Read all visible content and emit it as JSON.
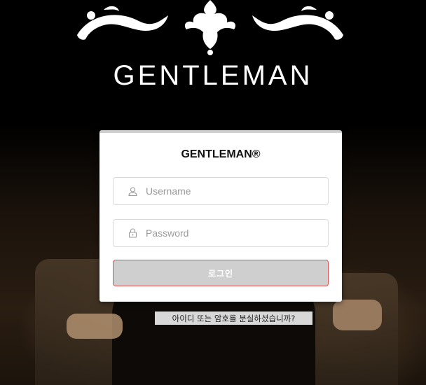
{
  "brand": {
    "name": "GENTLEMAN"
  },
  "login": {
    "title": "GENTLEMAN®",
    "username_placeholder": "Username",
    "password_placeholder": "Password",
    "submit_label": "로그인"
  },
  "forgot": {
    "label": "아이디 또는 암호를 분실하셨습니까?"
  },
  "icons": {
    "user": "user-icon",
    "lock": "lock-icon",
    "ornament": "ornament-icon"
  },
  "colors": {
    "button_border": "#e05252",
    "button_bg": "#cfcfcf"
  }
}
